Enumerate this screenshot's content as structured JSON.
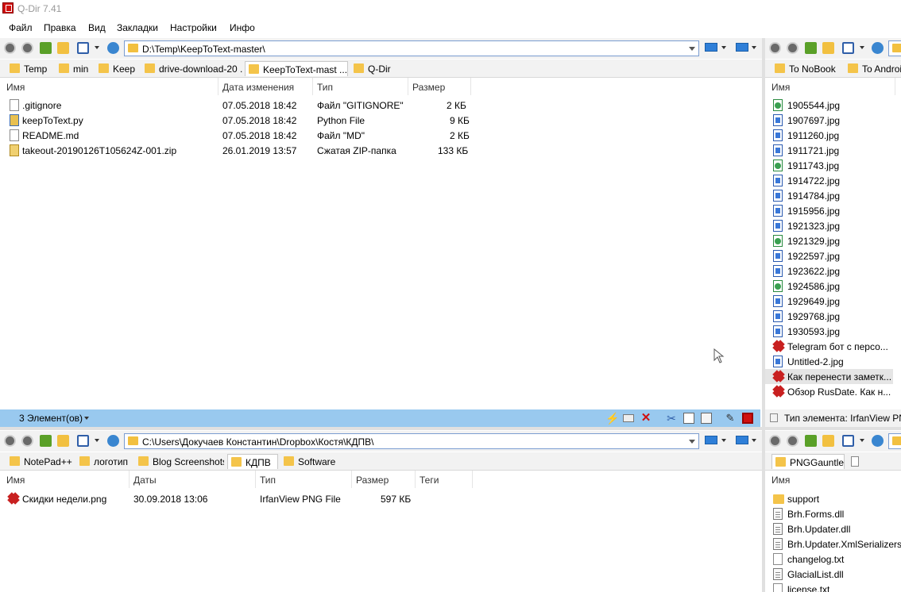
{
  "window": {
    "title": "Q-Dir 7.41"
  },
  "menu": [
    "Файл",
    "Правка",
    "Вид",
    "Закладки",
    "Настройки",
    "Инфо"
  ],
  "pane_top_left": {
    "path": "D:\\Temp\\KeepToText-master\\",
    "tabs": [
      "Temp",
      "min",
      "Keep",
      "drive-download-20 ...",
      "KeepToText-mast ...",
      "Q-Dir"
    ],
    "active_tab": 4,
    "columns": [
      "Имя",
      "Дата изменения",
      "Тип",
      "Размер"
    ],
    "rows": [
      {
        "icon": "text-file-icon",
        "name": ".gitignore",
        "date": "07.05.2018 18:42",
        "type": "Файл \"GITIGNORE\"",
        "size": "2 КБ"
      },
      {
        "icon": "python-file-icon",
        "name": "keepToText.py",
        "date": "07.05.2018 18:42",
        "type": "Python File",
        "size": "9 КБ"
      },
      {
        "icon": "text-file-icon",
        "name": "README.md",
        "date": "07.05.2018 18:42",
        "type": "Файл \"MD\"",
        "size": "2 КБ"
      },
      {
        "icon": "zip-file-icon",
        "name": "takeout-20190126T105624Z-001.zip",
        "date": "26.01.2019 13:57",
        "type": "Сжатая ZIP-папка",
        "size": "133 КБ"
      }
    ],
    "status": "3 Элемент(ов)"
  },
  "pane_top_right": {
    "tabs": [
      "To NoBook",
      "To Android"
    ],
    "columns": [
      "Имя"
    ],
    "rows": [
      {
        "icon": "jpg-green-icon",
        "name": "1905544.jpg"
      },
      {
        "icon": "jpg-icon",
        "name": "1907697.jpg"
      },
      {
        "icon": "jpg-icon",
        "name": "1911260.jpg"
      },
      {
        "icon": "jpg-icon",
        "name": "1911721.jpg"
      },
      {
        "icon": "jpg-green-icon",
        "name": "1911743.jpg"
      },
      {
        "icon": "jpg-icon",
        "name": "1914722.jpg"
      },
      {
        "icon": "jpg-icon",
        "name": "1914784.jpg"
      },
      {
        "icon": "jpg-icon",
        "name": "1915956.jpg"
      },
      {
        "icon": "jpg-icon",
        "name": "1921323.jpg"
      },
      {
        "icon": "jpg-green-icon",
        "name": "1921329.jpg"
      },
      {
        "icon": "jpg-icon",
        "name": "1922597.jpg"
      },
      {
        "icon": "jpg-icon",
        "name": "1923622.jpg"
      },
      {
        "icon": "jpg-green-icon",
        "name": "1924586.jpg"
      },
      {
        "icon": "jpg-icon",
        "name": "1929649.jpg"
      },
      {
        "icon": "jpg-icon",
        "name": "1929768.jpg"
      },
      {
        "icon": "jpg-icon",
        "name": "1930593.jpg"
      },
      {
        "icon": "irfanview-icon",
        "name": "Telegram бот с персо..."
      },
      {
        "icon": "jpg-icon",
        "name": "Untitled-2.jpg"
      },
      {
        "icon": "irfanview-icon",
        "name": "Как перенести заметк..."
      },
      {
        "icon": "irfanview-icon",
        "name": "Обзор RusDate. Как н..."
      }
    ],
    "status": "Тип элемента: IrfanView PNG"
  },
  "pane_bottom_left": {
    "path": "C:\\Users\\Докучаев Константин\\Dropbox\\Костя\\КДПВ\\",
    "tabs": [
      "NotePad++",
      "логотип",
      "Blog Screenshots",
      "КДПВ",
      "Software"
    ],
    "active_tab": 3,
    "columns": [
      "Имя",
      "Даты",
      "Тип",
      "Размер",
      "Теги"
    ],
    "rows": [
      {
        "icon": "irfanview-icon",
        "name": "Скидки недели.png",
        "date": "30.09.2018 13:06",
        "type": "IrfanView PNG File",
        "size": "597 КБ"
      }
    ]
  },
  "pane_bottom_right": {
    "tabs": [
      "PNGGauntlet"
    ],
    "columns": [
      "Имя"
    ],
    "rows": [
      {
        "icon": "folder-icon",
        "name": "support"
      },
      {
        "icon": "dll-file-icon",
        "name": "Brh.Forms.dll"
      },
      {
        "icon": "dll-file-icon",
        "name": "Brh.Updater.dll"
      },
      {
        "icon": "dll-file-icon",
        "name": "Brh.Updater.XmlSerializers.d"
      },
      {
        "icon": "text-file-icon",
        "name": "changelog.txt"
      },
      {
        "icon": "dll-file-icon",
        "name": "GlacialList.dll"
      },
      {
        "icon": "text-file-icon",
        "name": "license.txt"
      }
    ]
  },
  "colors": {
    "status_bar": "#99c9ef",
    "accent": "#2f7fd8",
    "folder": "#f4c44a"
  }
}
